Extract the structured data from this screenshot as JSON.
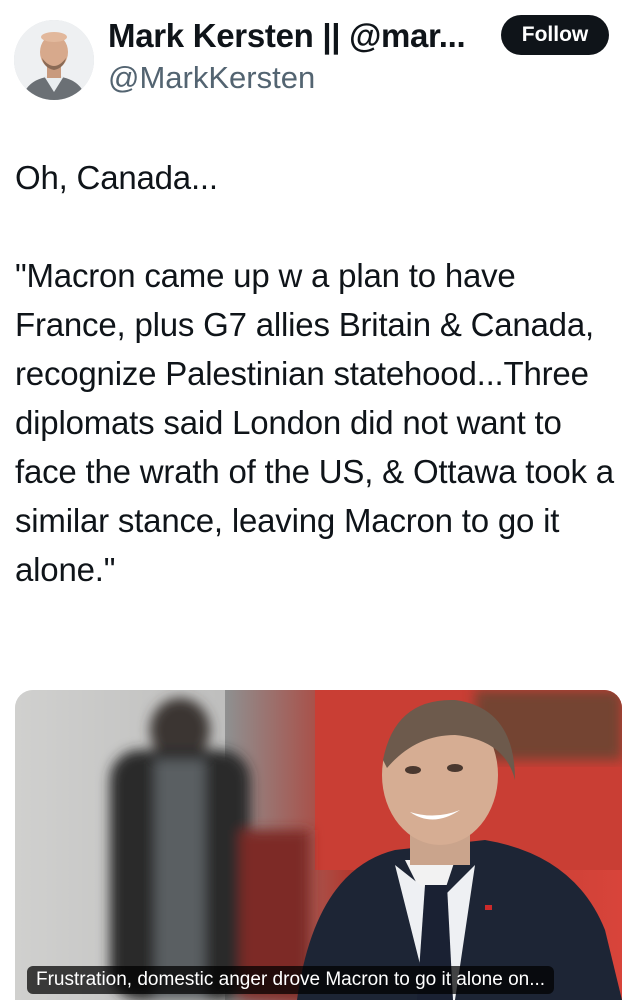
{
  "author": {
    "display_name": "Mark Kersten || @mar...",
    "handle": "@MarkKersten",
    "follow_label": "Follow"
  },
  "tweet": {
    "line1": "Oh, Canada...",
    "quote": "\"Macron came up w a plan to have France, plus G7 allies Britain & Canada, recognize Palestinian statehood...Three diplomats said London did not want to face the wrath of the US, & Ottawa took a similar stance, leaving Macron to go it alone.\""
  },
  "media": {
    "caption": "Frustration, domestic anger drove Macron to go it alone on..."
  },
  "colors": {
    "follow_bg": "#0f1419",
    "handle": "#536471",
    "text": "#0f1419"
  }
}
